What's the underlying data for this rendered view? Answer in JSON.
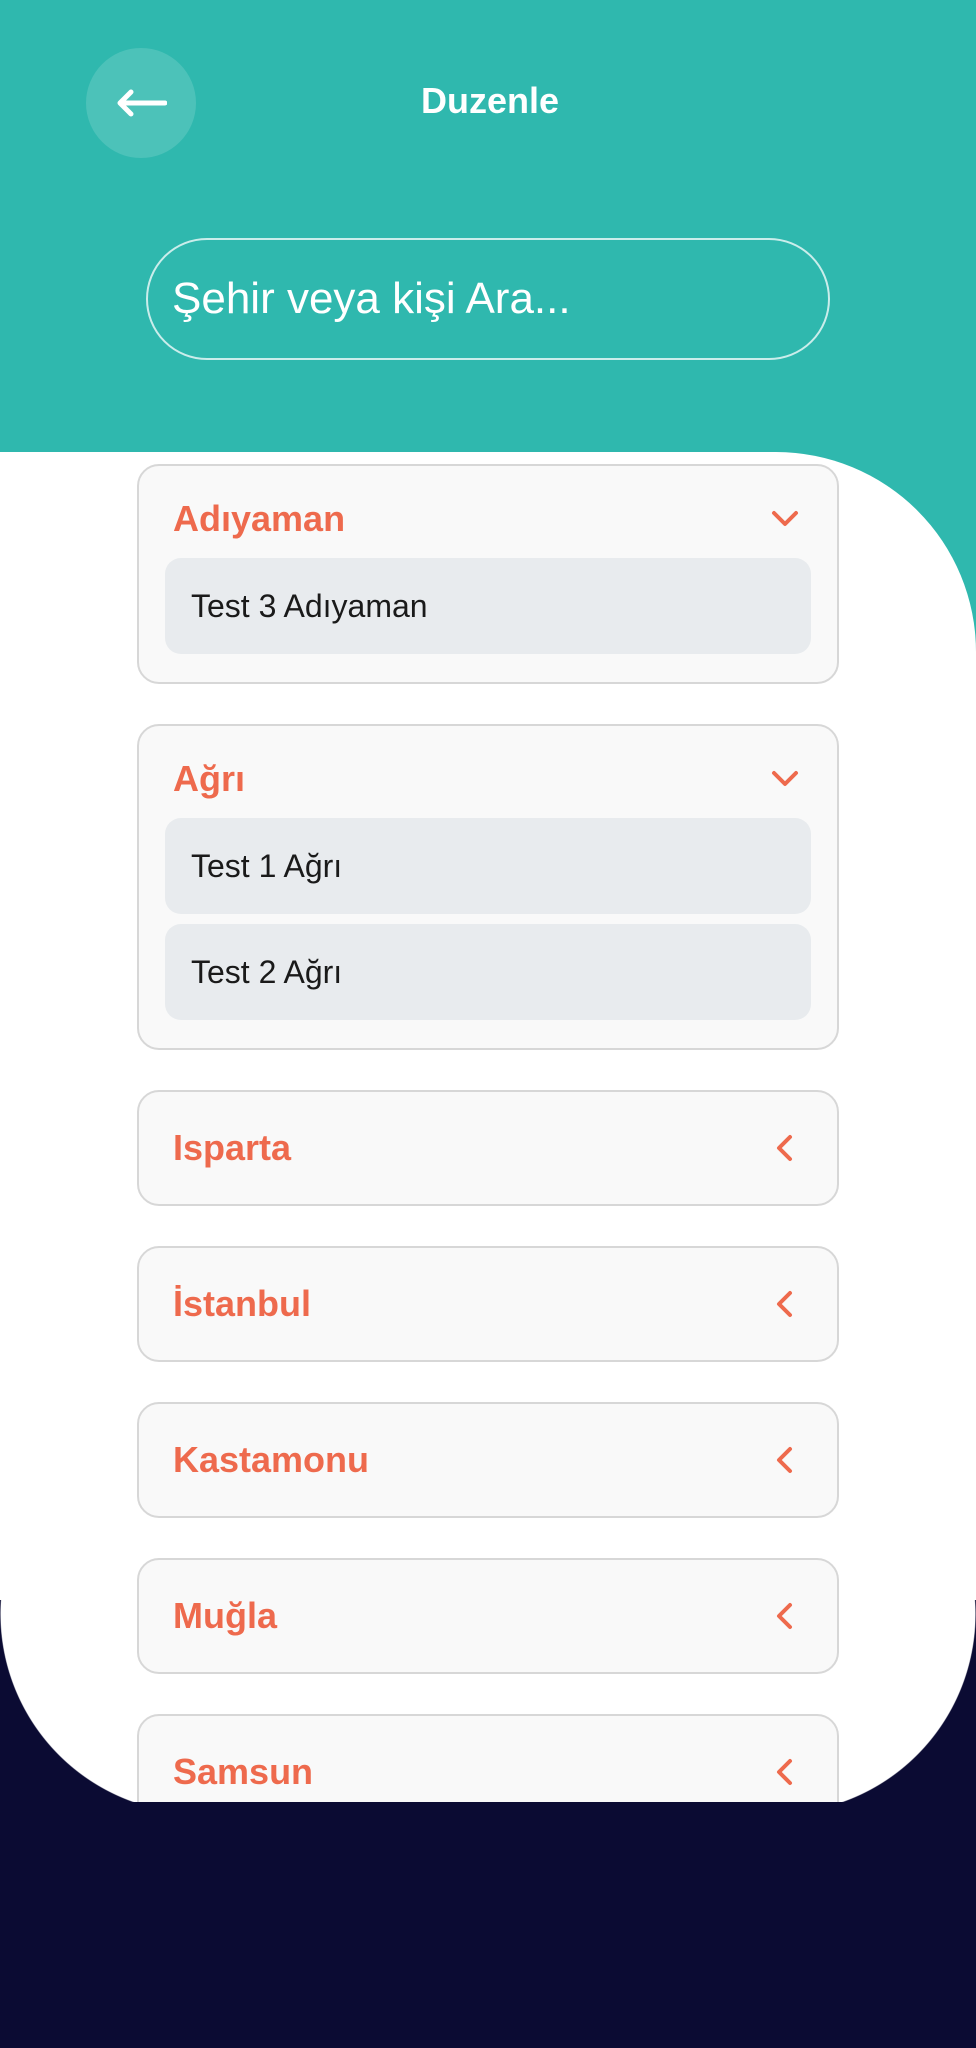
{
  "header": {
    "title": "Duzenle",
    "back_icon": "arrow-left-icon"
  },
  "search": {
    "placeholder": "Şehir veya kişi Ara...",
    "value": ""
  },
  "colors": {
    "teal": "#2fb8ae",
    "navy": "#0b0b33",
    "accent": "#ee6a4d",
    "item_bg": "#e8ebee"
  },
  "groups": [
    {
      "name": "Adıyaman",
      "expanded": true,
      "icon": "chevron-down-icon",
      "items": [
        "Test 3 Adıyaman"
      ]
    },
    {
      "name": "Ağrı",
      "expanded": true,
      "icon": "chevron-down-icon",
      "items": [
        "Test 1 Ağrı",
        "Test 2 Ağrı"
      ]
    },
    {
      "name": "Isparta",
      "expanded": false,
      "icon": "chevron-left-icon",
      "items": []
    },
    {
      "name": "İstanbul",
      "expanded": false,
      "icon": "chevron-left-icon",
      "items": []
    },
    {
      "name": "Kastamonu",
      "expanded": false,
      "icon": "chevron-left-icon",
      "items": []
    },
    {
      "name": "Muğla",
      "expanded": false,
      "icon": "chevron-left-icon",
      "items": []
    },
    {
      "name": "Samsun",
      "expanded": false,
      "icon": "chevron-left-icon",
      "items": []
    }
  ]
}
